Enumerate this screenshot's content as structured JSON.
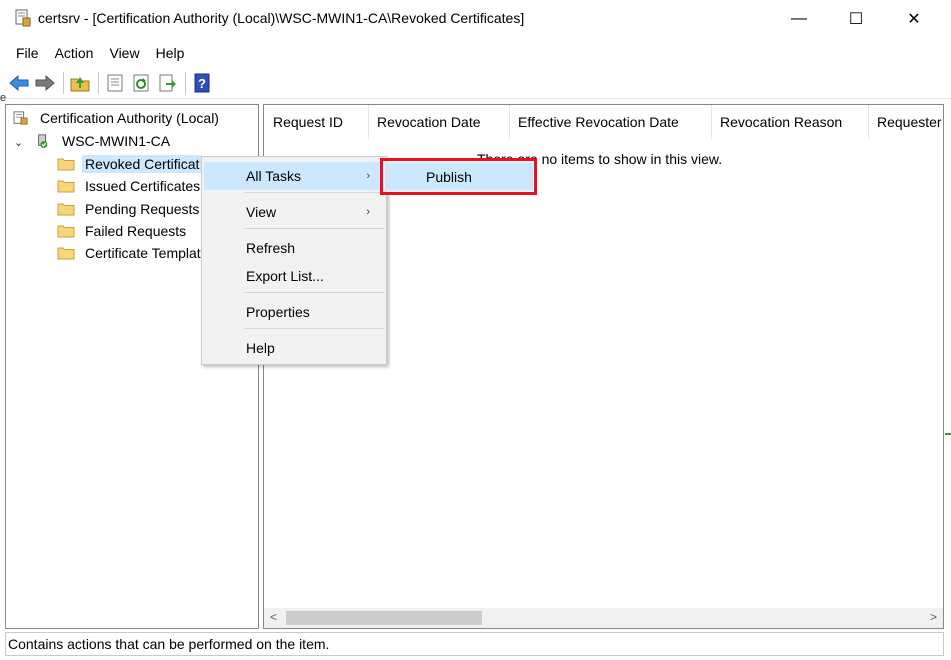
{
  "window": {
    "title": "certsrv - [Certification Authority (Local)\\WSC-MWIN1-CA\\Revoked Certificates]",
    "minimize_glyph": "—",
    "maximize_glyph": "☐",
    "close_glyph": "✕"
  },
  "menubar": {
    "items": [
      "File",
      "Action",
      "View",
      "Help"
    ]
  },
  "toolbar": {
    "buttons": [
      "back-arrow-icon",
      "forward-arrow-icon",
      "up-folder-icon",
      "properties-sheet-icon",
      "refresh-icon",
      "export-list-icon",
      "help-icon"
    ]
  },
  "tree": {
    "root_label": "Certification Authority (Local)",
    "ca_label": "WSC-MWIN1-CA",
    "expander_glyph": "⌄",
    "children": [
      {
        "label": "Revoked Certificat"
      },
      {
        "label": "Issued Certificates"
      },
      {
        "label": "Pending Requests"
      },
      {
        "label": "Failed Requests"
      },
      {
        "label": "Certificate Templat"
      }
    ]
  },
  "list": {
    "columns": [
      "Request ID",
      "Revocation Date",
      "Effective Revocation Date",
      "Revocation Reason",
      "Requester"
    ],
    "empty_message": "There are no items to show in this view.",
    "scroll_left": "<",
    "scroll_right": ">"
  },
  "context_menu": {
    "all_tasks": "All Tasks",
    "view": "View",
    "refresh": "Refresh",
    "export_list": "Export List...",
    "properties": "Properties",
    "help": "Help",
    "submenu_arrow": "›"
  },
  "submenu": {
    "publish": "Publish"
  },
  "statusbar": {
    "text": "Contains actions that can be performed on the item."
  },
  "colors": {
    "selection": "#cce8ff",
    "highlight_border": "#e81123",
    "folder": "#f5d77a"
  }
}
